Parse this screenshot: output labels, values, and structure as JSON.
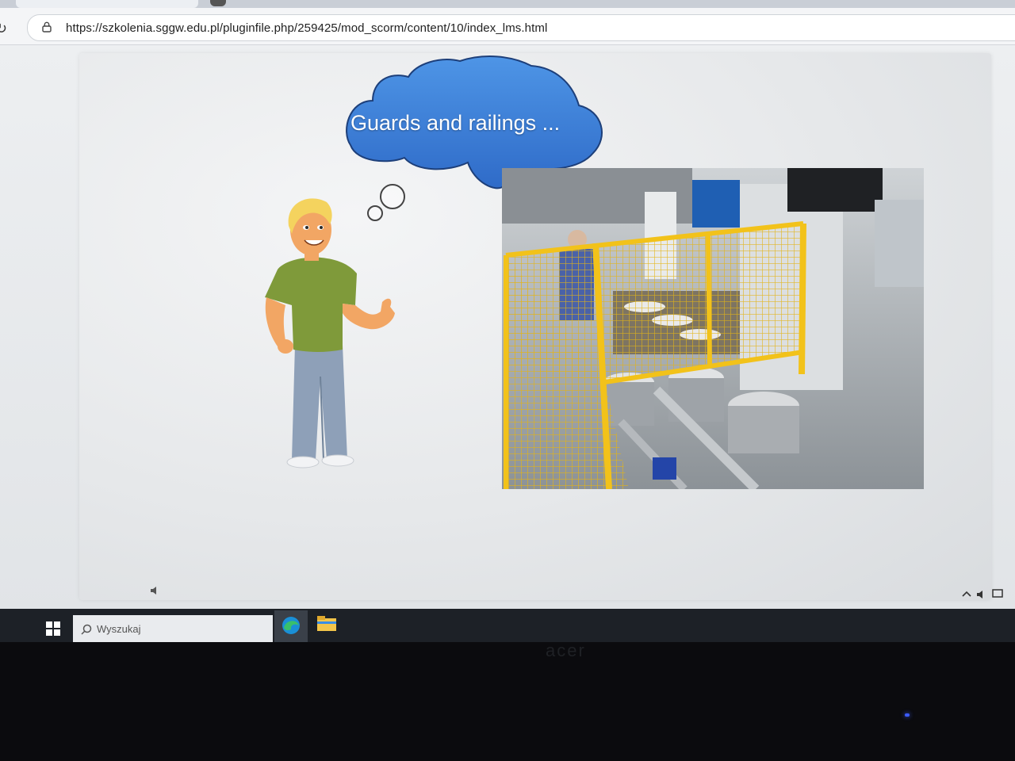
{
  "browser": {
    "url": "https://szkolenia.sggw.edu.pl/pluginfile.php/259425/mod_scorm/content/10/index_lms.html"
  },
  "slide": {
    "thought_text": "Guards and railings ..."
  },
  "taskbar": {
    "search_placeholder": "Wyszukaj"
  },
  "monitor": {
    "brand": "acer"
  },
  "colors": {
    "cloud": "#3f7fd6",
    "railing": "#f2c21a",
    "shirt": "#7f9a3a",
    "taskbar": "#1d2127"
  }
}
